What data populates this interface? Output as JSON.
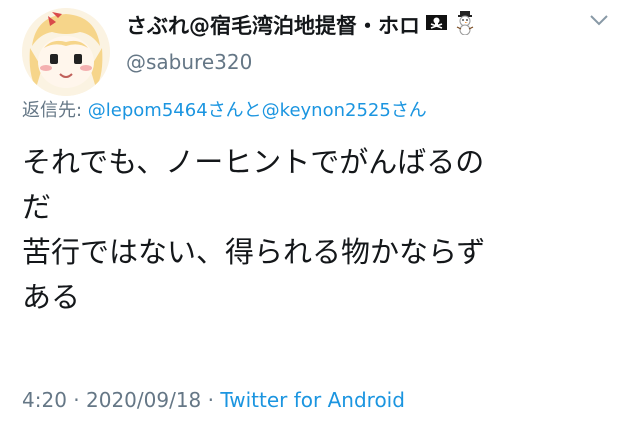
{
  "author": {
    "display_name": "さぶれ@宿毛湾泊地提督・ホロ",
    "handle": "@sabure320",
    "avatar_icon": "anime-girl-avatar",
    "name_emojis": [
      "pirate-flag-icon",
      "snowman-icon"
    ]
  },
  "menu": {
    "icon": "chevron-down-icon"
  },
  "reply": {
    "prefix": "返信先: ",
    "user1": "@lepom5464",
    "conj1": "さんと",
    "user2": "@keynon2525",
    "conj2": "さん"
  },
  "tweet": {
    "lines": [
      "それでも、ノーヒントでがんばるの",
      "だ",
      "苦行ではない、得られる物かならず",
      "ある"
    ]
  },
  "meta": {
    "time": "4:20",
    "sep1": " · ",
    "date": "2020/09/18",
    "sep2": " · ",
    "source": "Twitter for Android"
  },
  "colors": {
    "link": "#1b95e0",
    "secondary": "#657786",
    "text": "#14171a"
  }
}
